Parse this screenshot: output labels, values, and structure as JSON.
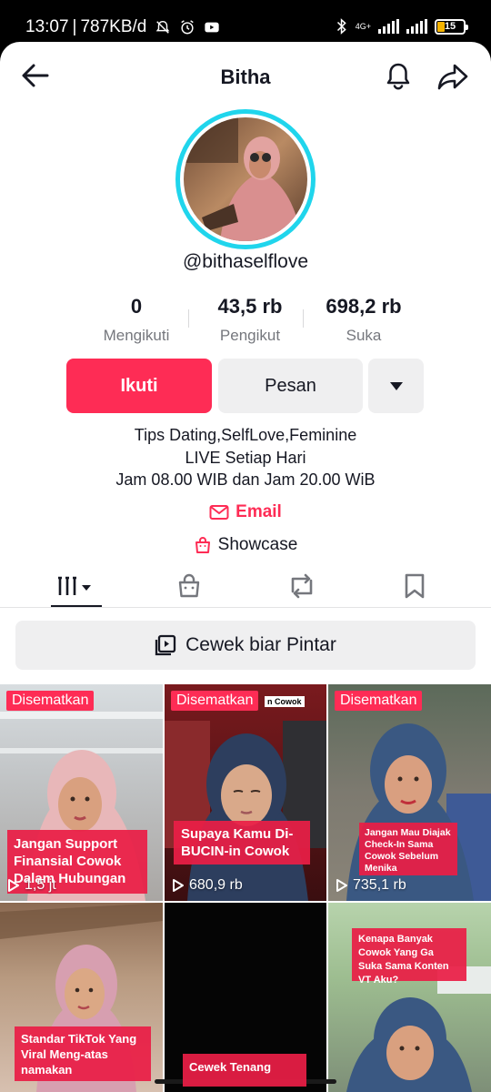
{
  "status_bar": {
    "time": "13:07",
    "network_speed": "787KB/d",
    "network_tag": "4G+",
    "battery_level": "15"
  },
  "header": {
    "title": "Bitha",
    "back_icon": "arrow-left-icon",
    "bell_icon": "bell-icon",
    "share_icon": "share-arrow-icon"
  },
  "profile": {
    "username": "@bithaselflove",
    "stats": [
      {
        "value": "0",
        "label": "Mengikuti"
      },
      {
        "value": "43,5 rb",
        "label": "Pengikut"
      },
      {
        "value": "698,2 rb",
        "label": "Suka"
      }
    ],
    "buttons": {
      "follow": "Ikuti",
      "message": "Pesan"
    },
    "bio": {
      "line1": "Tips Dating,SelfLove,Feminine",
      "line2": "LIVE Setiap Hari",
      "line3": "Jam 08.00 WIB dan Jam 20.00 WiB"
    },
    "email_label": "Email",
    "showcase_label": "Showcase"
  },
  "tabs": [
    "videos-grid-icon",
    "shop-bag-icon",
    "repost-icon",
    "bookmark-icon"
  ],
  "playlist_label": "Cewek biar Pintar",
  "videos": [
    {
      "pinned": "Disematkan",
      "caption": "Jangan Support Finansial Cowok Dalam Hubungan",
      "views": "1,5 jt"
    },
    {
      "pinned": "Disematkan",
      "caption": "Supaya Kamu Di-BUCIN-in Cowok",
      "views": "680,9 rb",
      "sign": "n Cowok"
    },
    {
      "pinned": "Disematkan",
      "caption": "Jangan Mau Diajak Check-In Sama Cowok Sebelum Menika",
      "views": "735,1 rb"
    },
    {
      "caption": "Standar TikTok Yang Viral Meng-atas namakan"
    },
    {
      "caption": "Cewek Tenang"
    },
    {
      "caption": "Kenapa Banyak Cowok Yang Ga Suka Sama Konten VT Aku?"
    }
  ],
  "colors": {
    "accent": "#fe2c55",
    "avatar_ring": "#20d5ec",
    "button_grey": "#efeff0"
  }
}
